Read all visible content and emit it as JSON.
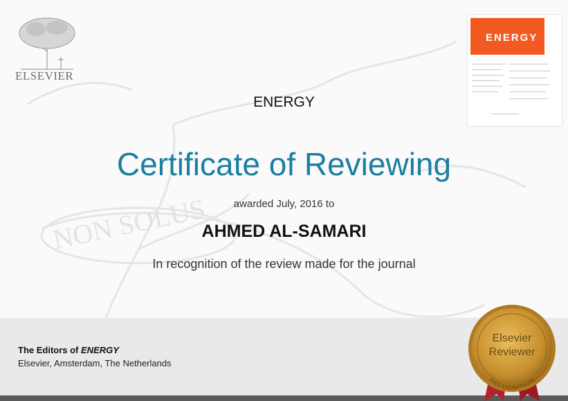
{
  "publisher": {
    "name": "ELSEVIER"
  },
  "journal": {
    "name": "ENERGY",
    "cover_title": "ENERGY"
  },
  "certificate": {
    "title": "Certificate of Reviewing",
    "awarded_text": "awarded July, 2016 to",
    "recipient": "AHMED AL-SAMARI",
    "recognition_text": "In recognition of the review made for the journal"
  },
  "footer": {
    "editors_prefix": "The Editors of ",
    "editors_journal": "ENERGY",
    "location": "Elsevier, Amsterdam, The Netherlands"
  },
  "seal": {
    "line1": "Elsevier",
    "line2": "Reviewer",
    "arc": "RECOGNITION"
  },
  "colors": {
    "title": "#1a7fa1",
    "cover_band": "#f25a22",
    "seal_gold": "#c8902e",
    "ribbon": "#b1222d"
  }
}
